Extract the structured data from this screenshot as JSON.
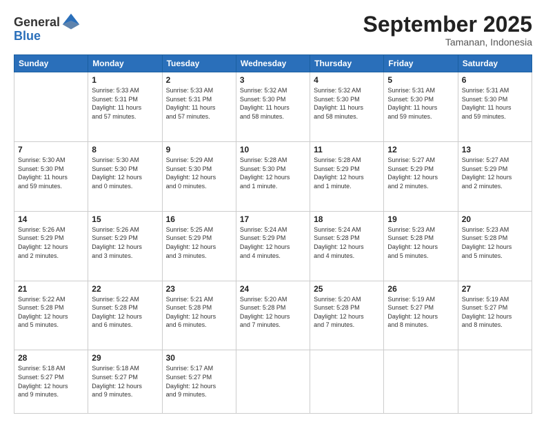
{
  "header": {
    "logo_line1": "General",
    "logo_line2": "Blue",
    "month_title": "September 2025",
    "location": "Tamanan, Indonesia"
  },
  "weekdays": [
    "Sunday",
    "Monday",
    "Tuesday",
    "Wednesday",
    "Thursday",
    "Friday",
    "Saturday"
  ],
  "weeks": [
    [
      {
        "day": "",
        "info": ""
      },
      {
        "day": "1",
        "info": "Sunrise: 5:33 AM\nSunset: 5:31 PM\nDaylight: 11 hours\nand 57 minutes."
      },
      {
        "day": "2",
        "info": "Sunrise: 5:33 AM\nSunset: 5:31 PM\nDaylight: 11 hours\nand 57 minutes."
      },
      {
        "day": "3",
        "info": "Sunrise: 5:32 AM\nSunset: 5:30 PM\nDaylight: 11 hours\nand 58 minutes."
      },
      {
        "day": "4",
        "info": "Sunrise: 5:32 AM\nSunset: 5:30 PM\nDaylight: 11 hours\nand 58 minutes."
      },
      {
        "day": "5",
        "info": "Sunrise: 5:31 AM\nSunset: 5:30 PM\nDaylight: 11 hours\nand 59 minutes."
      },
      {
        "day": "6",
        "info": "Sunrise: 5:31 AM\nSunset: 5:30 PM\nDaylight: 11 hours\nand 59 minutes."
      }
    ],
    [
      {
        "day": "7",
        "info": "Sunrise: 5:30 AM\nSunset: 5:30 PM\nDaylight: 11 hours\nand 59 minutes."
      },
      {
        "day": "8",
        "info": "Sunrise: 5:30 AM\nSunset: 5:30 PM\nDaylight: 12 hours\nand 0 minutes."
      },
      {
        "day": "9",
        "info": "Sunrise: 5:29 AM\nSunset: 5:30 PM\nDaylight: 12 hours\nand 0 minutes."
      },
      {
        "day": "10",
        "info": "Sunrise: 5:28 AM\nSunset: 5:30 PM\nDaylight: 12 hours\nand 1 minute."
      },
      {
        "day": "11",
        "info": "Sunrise: 5:28 AM\nSunset: 5:29 PM\nDaylight: 12 hours\nand 1 minute."
      },
      {
        "day": "12",
        "info": "Sunrise: 5:27 AM\nSunset: 5:29 PM\nDaylight: 12 hours\nand 2 minutes."
      },
      {
        "day": "13",
        "info": "Sunrise: 5:27 AM\nSunset: 5:29 PM\nDaylight: 12 hours\nand 2 minutes."
      }
    ],
    [
      {
        "day": "14",
        "info": "Sunrise: 5:26 AM\nSunset: 5:29 PM\nDaylight: 12 hours\nand 2 minutes."
      },
      {
        "day": "15",
        "info": "Sunrise: 5:26 AM\nSunset: 5:29 PM\nDaylight: 12 hours\nand 3 minutes."
      },
      {
        "day": "16",
        "info": "Sunrise: 5:25 AM\nSunset: 5:29 PM\nDaylight: 12 hours\nand 3 minutes."
      },
      {
        "day": "17",
        "info": "Sunrise: 5:24 AM\nSunset: 5:29 PM\nDaylight: 12 hours\nand 4 minutes."
      },
      {
        "day": "18",
        "info": "Sunrise: 5:24 AM\nSunset: 5:28 PM\nDaylight: 12 hours\nand 4 minutes."
      },
      {
        "day": "19",
        "info": "Sunrise: 5:23 AM\nSunset: 5:28 PM\nDaylight: 12 hours\nand 5 minutes."
      },
      {
        "day": "20",
        "info": "Sunrise: 5:23 AM\nSunset: 5:28 PM\nDaylight: 12 hours\nand 5 minutes."
      }
    ],
    [
      {
        "day": "21",
        "info": "Sunrise: 5:22 AM\nSunset: 5:28 PM\nDaylight: 12 hours\nand 5 minutes."
      },
      {
        "day": "22",
        "info": "Sunrise: 5:22 AM\nSunset: 5:28 PM\nDaylight: 12 hours\nand 6 minutes."
      },
      {
        "day": "23",
        "info": "Sunrise: 5:21 AM\nSunset: 5:28 PM\nDaylight: 12 hours\nand 6 minutes."
      },
      {
        "day": "24",
        "info": "Sunrise: 5:20 AM\nSunset: 5:28 PM\nDaylight: 12 hours\nand 7 minutes."
      },
      {
        "day": "25",
        "info": "Sunrise: 5:20 AM\nSunset: 5:28 PM\nDaylight: 12 hours\nand 7 minutes."
      },
      {
        "day": "26",
        "info": "Sunrise: 5:19 AM\nSunset: 5:27 PM\nDaylight: 12 hours\nand 8 minutes."
      },
      {
        "day": "27",
        "info": "Sunrise: 5:19 AM\nSunset: 5:27 PM\nDaylight: 12 hours\nand 8 minutes."
      }
    ],
    [
      {
        "day": "28",
        "info": "Sunrise: 5:18 AM\nSunset: 5:27 PM\nDaylight: 12 hours\nand 9 minutes."
      },
      {
        "day": "29",
        "info": "Sunrise: 5:18 AM\nSunset: 5:27 PM\nDaylight: 12 hours\nand 9 minutes."
      },
      {
        "day": "30",
        "info": "Sunrise: 5:17 AM\nSunset: 5:27 PM\nDaylight: 12 hours\nand 9 minutes."
      },
      {
        "day": "",
        "info": ""
      },
      {
        "day": "",
        "info": ""
      },
      {
        "day": "",
        "info": ""
      },
      {
        "day": "",
        "info": ""
      }
    ]
  ]
}
